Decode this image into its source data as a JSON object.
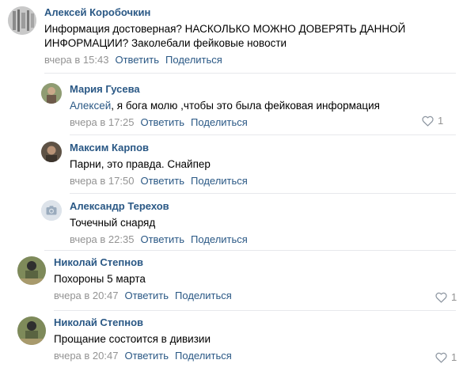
{
  "comments": [
    {
      "author": "Алексей Коробочкин",
      "text": "Информация достоверная? НАСКОЛЬКО МОЖНО ДОВЕРЯТЬ ДАННОЙ ИНФОРМАЦИИ? Заколебали фейковые новости",
      "date": "вчера в 15:43",
      "reply": "Ответить",
      "share": "Поделиться"
    },
    {
      "author": "Мария Гусева",
      "reply_to": "Алексей",
      "text": ", я бога молю ,чтобы это была фейковая информация",
      "date": "вчера в 17:25",
      "reply": "Ответить",
      "share": "Поделиться",
      "likes": "1"
    },
    {
      "author": "Максим Карпов",
      "text": "Парни, это правда. Снайпер",
      "date": "вчера в 17:50",
      "reply": "Ответить",
      "share": "Поделиться"
    },
    {
      "author": "Александр Терехов",
      "text": "Точечный снаряд",
      "date": "вчера в 22:35",
      "reply": "Ответить",
      "share": "Поделиться"
    },
    {
      "author": "Николай Степнов",
      "text": "Похороны 5 марта",
      "date": "вчера в 20:47",
      "reply": "Ответить",
      "share": "Поделиться",
      "likes": "1"
    },
    {
      "author": "Николай Степнов",
      "text": "Прощание состоится в дивизии",
      "date": "вчера в 20:47",
      "reply": "Ответить",
      "share": "Поделиться",
      "likes": "1"
    }
  ],
  "icons": {
    "like": "heart-outline-icon",
    "camera": "camera-placeholder-icon"
  },
  "colors": {
    "link": "#2a5885",
    "meta": "#939393",
    "divider": "#e7e8ec",
    "text": "#000000"
  }
}
